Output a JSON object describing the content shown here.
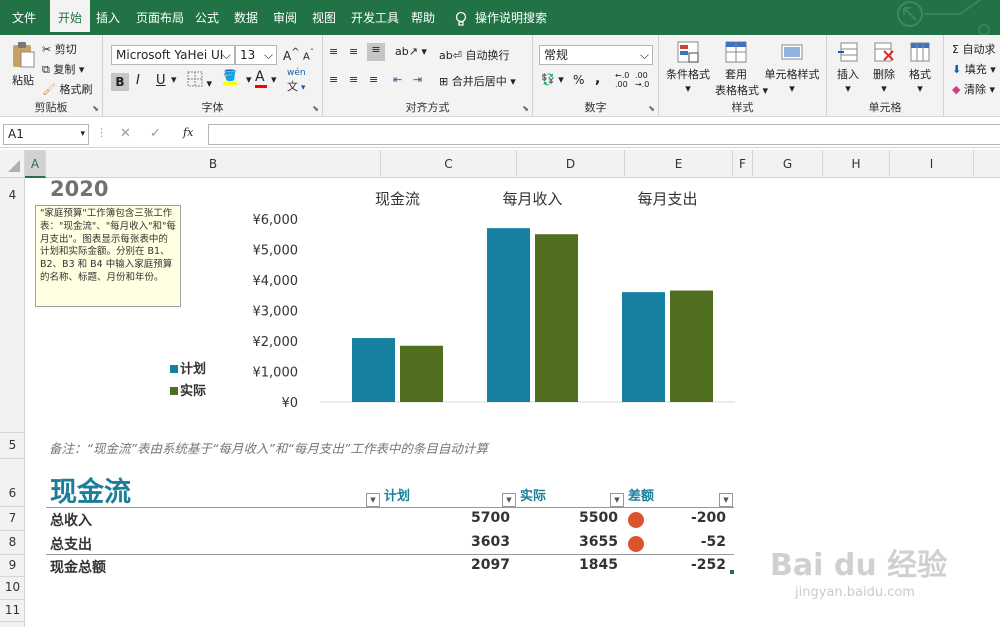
{
  "ribbon_tabs": [
    {
      "label": "文件"
    },
    {
      "label": "开始"
    },
    {
      "label": "插入"
    },
    {
      "label": "页面布局"
    },
    {
      "label": "公式"
    },
    {
      "label": "数据"
    },
    {
      "label": "审阅"
    },
    {
      "label": "视图"
    },
    {
      "label": "开发工具"
    },
    {
      "label": "帮助"
    }
  ],
  "tell_me": "操作说明搜索",
  "clipboard": {
    "paste": "粘贴",
    "cut": "剪切",
    "copy": "复制",
    "format_painter": "格式刷",
    "label": "剪贴板"
  },
  "font": {
    "name": "Microsoft YaHei UI",
    "size": "13",
    "bold": "B",
    "italic": "I",
    "underline": "U",
    "label": "字体",
    "font_color_letter": "A",
    "wen": "wén"
  },
  "alignment": {
    "wrap": "自动换行",
    "merge": "合并后居中",
    "label": "对齐方式"
  },
  "number": {
    "format": "常规",
    "percent": "%",
    "comma": ",",
    "label": "数字"
  },
  "styles": {
    "conditional": "条件格式",
    "table1": "套用",
    "table2": "表格格式",
    "cell_styles": "单元格样式",
    "label": "样式"
  },
  "cells": {
    "insert": "插入",
    "delete": "删除",
    "format": "格式",
    "label": "单元格"
  },
  "editing": {
    "autosum": "自动求",
    "fill": "填充",
    "clear": "清除"
  },
  "formula_bar": {
    "name_box": "A1",
    "fx": "fx",
    "content": ""
  },
  "columns": [
    "A",
    "B",
    "C",
    "D",
    "E",
    "F",
    "G",
    "H",
    "I"
  ],
  "rows": [
    "4",
    "5",
    "6",
    "7",
    "8",
    "9",
    "10",
    "11"
  ],
  "year": "2020",
  "note_text": "\"家庭预算\"工作簿包含三张工作表：\"现金流\"、\"每月收入\"和\"每月支出\"。图表显示每张表中的计划和实际金额。分别在 B1、B2、B3 和 B4 中输入家庭预算的名称、标题、月份和年份。",
  "remark": "备注：“现金流”表由系统基于“每月收入”和“每月支出”工作表中的条目自动计算",
  "colors": {
    "plan": "#1680a0",
    "actual": "#4f6f1f",
    "excel_green": "#217346",
    "title_teal": "#1b7f99",
    "dot": "#d9532c"
  },
  "chart_data": {
    "type": "bar",
    "categories": [
      "现金流",
      "每月收入",
      "每月支出"
    ],
    "series": [
      {
        "name": "计划",
        "values": [
          2097,
          5700,
          3603
        ]
      },
      {
        "name": "实际",
        "values": [
          1845,
          5500,
          3655
        ]
      }
    ],
    "yticks": [
      "¥0",
      "¥1,000",
      "¥2,000",
      "¥3,000",
      "¥4,000",
      "¥5,000",
      "¥6,000"
    ],
    "ylim": [
      0,
      6000
    ],
    "legend_position": "left"
  },
  "table": {
    "title": "现金流",
    "headers": [
      "计划",
      "实际",
      "差额"
    ],
    "rows": [
      {
        "label": "总收入",
        "plan": "5700",
        "actual": "5500",
        "diff": "-200"
      },
      {
        "label": "总支出",
        "plan": "3603",
        "actual": "3655",
        "diff": "-52"
      },
      {
        "label": "现金总额",
        "plan": "2097",
        "actual": "1845",
        "diff": "-252"
      }
    ]
  },
  "watermark": {
    "brand": "Bai du 经验",
    "url": "jingyan.baidu.com"
  }
}
